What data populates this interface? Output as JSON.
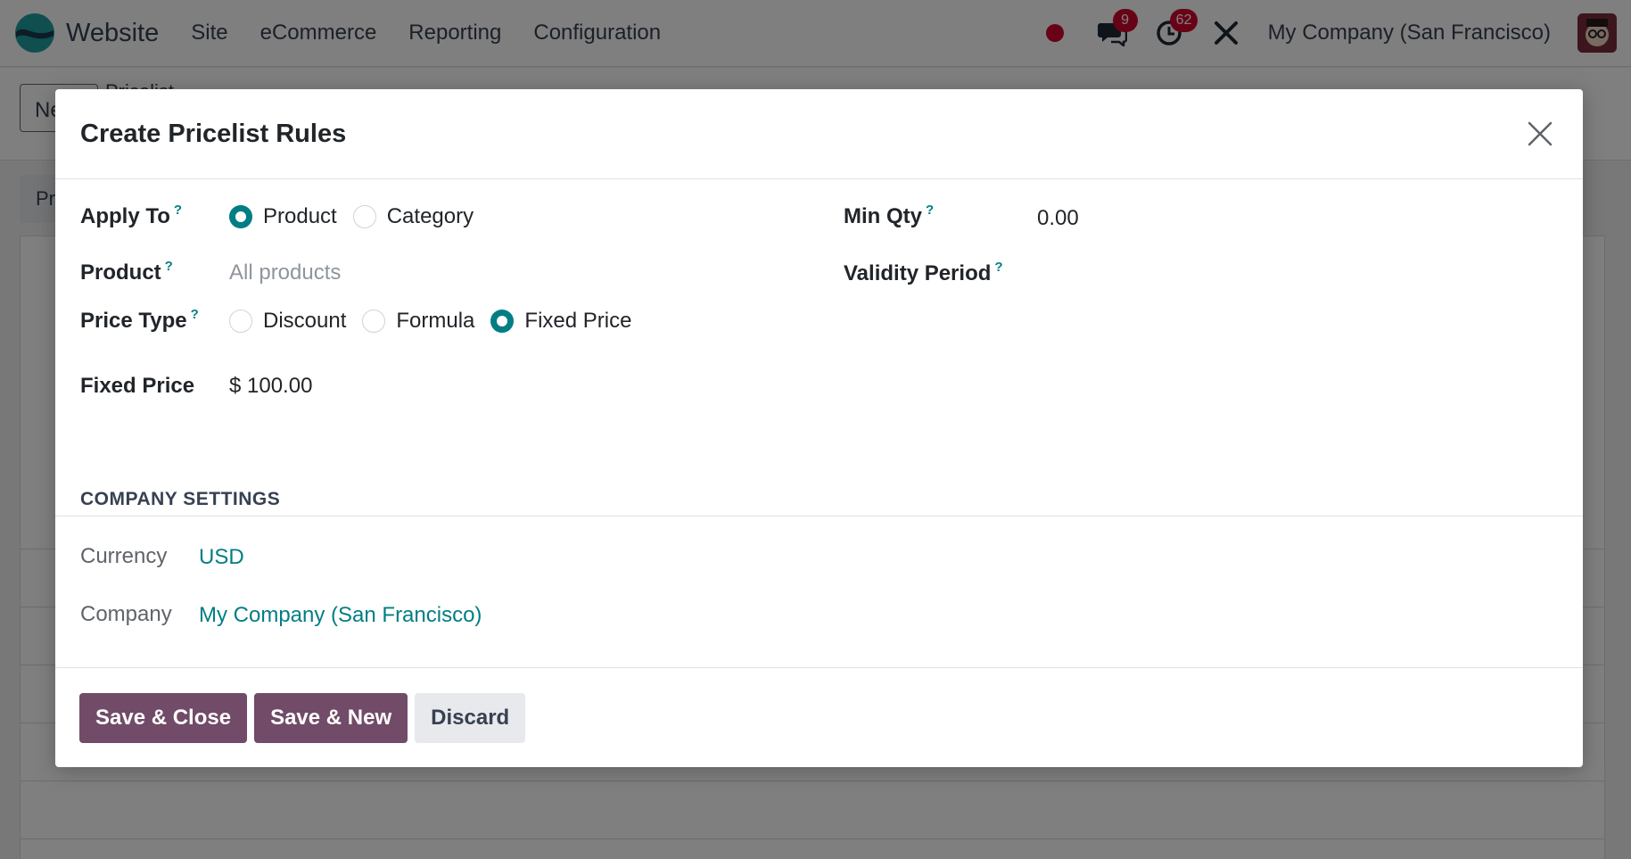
{
  "navbar": {
    "brand": "Website",
    "menu": [
      "Site",
      "eCommerce",
      "Reporting",
      "Configuration"
    ],
    "messages_count": "9",
    "activities_count": "62",
    "company": "My Company (San Francisco)"
  },
  "background": {
    "new_button": "Ne",
    "breadcrumb": "Pricelist",
    "tab": "Pr"
  },
  "modal": {
    "title": "Create Pricelist Rules",
    "fields": {
      "apply_to": {
        "label": "Apply To",
        "help": "?",
        "options": [
          "Product",
          "Category"
        ],
        "selected": "Product"
      },
      "product": {
        "label": "Product",
        "help": "?",
        "placeholder": "All products"
      },
      "price_type": {
        "label": "Price Type",
        "help": "?",
        "options": [
          "Discount",
          "Formula",
          "Fixed Price"
        ],
        "selected": "Fixed Price"
      },
      "fixed_price": {
        "label": "Fixed Price",
        "value": "$ 100.00"
      },
      "min_qty": {
        "label": "Min Qty",
        "help": "?",
        "value": "0.00"
      },
      "validity_period": {
        "label": "Validity Period",
        "help": "?"
      }
    },
    "company_settings": {
      "title": "COMPANY SETTINGS",
      "currency_label": "Currency",
      "currency_value": "USD",
      "company_label": "Company",
      "company_value": "My Company (San Francisco)"
    },
    "footer": {
      "save_close": "Save & Close",
      "save_new": "Save & New",
      "discard": "Discard"
    }
  },
  "colors": {
    "primary": "#714b67",
    "accent": "#017e84",
    "badge": "#d1062e"
  }
}
